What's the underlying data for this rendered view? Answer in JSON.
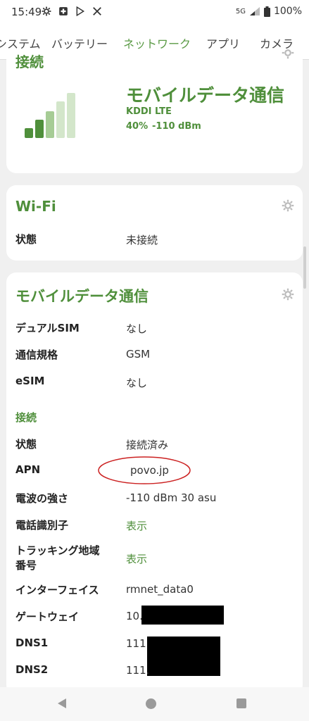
{
  "status_bar": {
    "time": "15:49",
    "network": "5G",
    "battery": "100%",
    "icons": [
      "gear-icon",
      "plus-box-icon",
      "play-store-icon",
      "tools-icon"
    ]
  },
  "tabs": [
    {
      "label": "システム"
    },
    {
      "label": "バッテリー"
    },
    {
      "label": "ネットワーク",
      "active": true
    },
    {
      "label": "アプリ"
    },
    {
      "label": "カメラ"
    }
  ],
  "connection_card": {
    "partial_title": "接続",
    "signal_title": "モバイルデータ通信",
    "carrier": "KDDI LTE",
    "signal_percent": "40%",
    "signal_dbm": "-110 dBm",
    "signal_level": 0.4
  },
  "wifi_card": {
    "title": "Wi-Fi",
    "rows": [
      {
        "label": "状態",
        "value": "未接続"
      }
    ]
  },
  "mobile_card": {
    "title": "モバイルデータ通信",
    "rows": [
      {
        "label": "デュアルSIM",
        "value": "なし"
      },
      {
        "label": "通信規格",
        "value": "GSM"
      },
      {
        "label": "eSIM",
        "value": "なし"
      }
    ],
    "section_label": "接続",
    "conn_rows": [
      {
        "label": "状態",
        "value": "接続済み"
      },
      {
        "label": "APN",
        "value": "povo.jp"
      },
      {
        "label": "電波の強さ",
        "value": "-110 dBm 30 asu"
      },
      {
        "label": "電話識別子",
        "value": "表示"
      },
      {
        "label": "トラッキング地域",
        "label2": "番号",
        "value": "表示"
      },
      {
        "label": "インターフェイス",
        "value": "rmnet_data0"
      },
      {
        "label": "ゲートウェイ",
        "value": "10."
      },
      {
        "label": "DNS1",
        "value": "111."
      },
      {
        "label": "DNS2",
        "value": "111."
      }
    ]
  },
  "colors": {
    "accent": "#4f8f3b",
    "tab_active": "#5a9a45",
    "background": "#f0f0f0",
    "card": "#ffffff",
    "annotation_circle": "#cc2222"
  }
}
